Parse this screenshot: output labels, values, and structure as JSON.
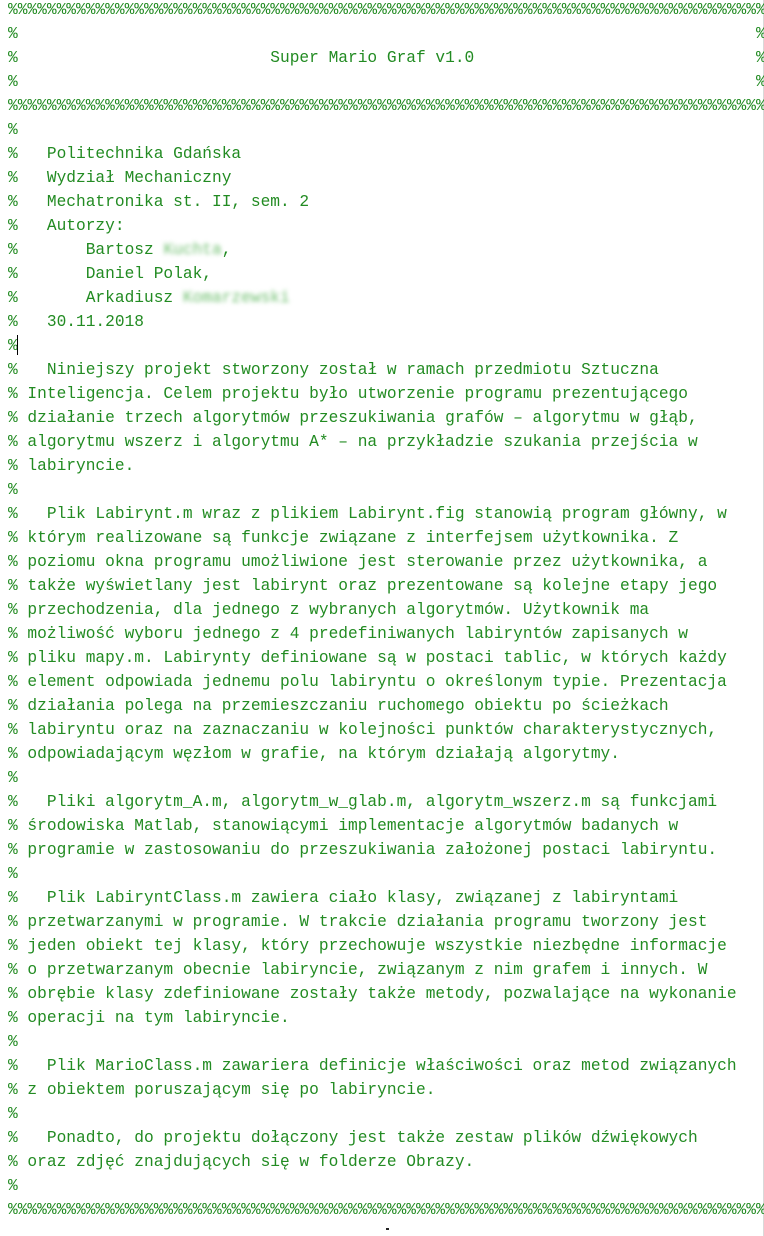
{
  "document": {
    "lines": [
      "%%%%%%%%%%%%%%%%%%%%%%%%%%%%%%%%%%%%%%%%%%%%%%%%%%%%%%%%%%%%%%%%%%%%%%%%%%%%%%",
      "%                                                                            %",
      "%                          Super Mario Graf v1.0                             %",
      "%                                                                            %",
      "%%%%%%%%%%%%%%%%%%%%%%%%%%%%%%%%%%%%%%%%%%%%%%%%%%%%%%%%%%%%%%%%%%%%%%%%%%%%%%",
      "%",
      "%   Politechnika Gdańska",
      "%   Wydział Mechaniczny",
      "%   Mechatronika st. II, sem. 2",
      "%   Autorzy:",
      "%       Bartosz ",
      "%       Daniel Polak,",
      "%       Arkadiusz ",
      "%   30.11.2018",
      "%",
      "%   Niniejszy projekt stworzony został w ramach przedmiotu Sztuczna",
      "% Inteligencja. Celem projektu było utworzenie programu prezentującego",
      "% działanie trzech algorytmów przeszukiwania grafów – algorytmu w głąb,",
      "% algorytmu wszerz i algorytmu A* – na przykładzie szukania przejścia w",
      "% labiryncie.",
      "%",
      "%   Plik Labirynt.m wraz z plikiem Labirynt.fig stanowią program główny, w",
      "% którym realizowane są funkcje związane z interfejsem użytkownika. Z",
      "% poziomu okna programu umożliwione jest sterowanie przez użytkownika, a",
      "% także wyświetlany jest labirynt oraz prezentowane są kolejne etapy jego",
      "% przechodzenia, dla jednego z wybranych algorytmów. Użytkownik ma",
      "% możliwość wyboru jednego z 4 predefiniwanych labiryntów zapisanych w",
      "% pliku mapy.m. Labirynty definiowane są w postaci tablic, w których każdy",
      "% element odpowiada jednemu polu labiryntu o określonym typie. Prezentacja",
      "% działania polega na przemieszczaniu ruchomego obiektu po ścieżkach",
      "% labiryntu oraz na zaznaczaniu w kolejności punktów charakterystycznych,",
      "% odpowiadającym węzłom w grafie, na którym działają algorytmy.",
      "%",
      "%   Pliki algorytm_A.m, algorytm_w_glab.m, algorytm_wszerz.m są funkcjami",
      "% środowiska Matlab, stanowiącymi implementacje algorytmów badanych w",
      "% programie w zastosowaniu do przeszukiwania założonej postaci labiryntu.",
      "%",
      "%   Plik LabiryntClass.m zawiera ciało klasy, związanej z labiryntami",
      "% przetwarzanymi w programie. W trakcie działania programu tworzony jest",
      "% jeden obiekt tej klasy, który przechowuje wszystkie niezbędne informacje",
      "% o przetwarzanym obecnie labiryncie, związanym z nim grafem i innych. W",
      "% obrębie klasy zdefiniowane zostały także metody, pozwalające na wykonanie",
      "% operacji na tym labiryncie.",
      "%",
      "%   Plik MarioClass.m zawariera definicje właściwości oraz metod związanych",
      "% z obiektem poruszającym się po labiryncie.",
      "%",
      "%   Ponadto, do projektu dołączony jest także zestaw plików dźwiękowych",
      "% oraz zdjęć znajdujących się w folderze Obrazy.",
      "%",
      "%%%%%%%%%%%%%%%%%%%%%%%%%%%%%%%%%%%%%%%%%%%%%%%%%%%%%%%%%%%%%%%%%%%%%%%%%%%%%%"
    ],
    "redacted": {
      "author1_surname": "Kuchta",
      "author1_suffix": ",",
      "author3_surname": "Komarzewski"
    }
  },
  "colors": {
    "comment": "#228b22",
    "background": "#ffffff"
  }
}
